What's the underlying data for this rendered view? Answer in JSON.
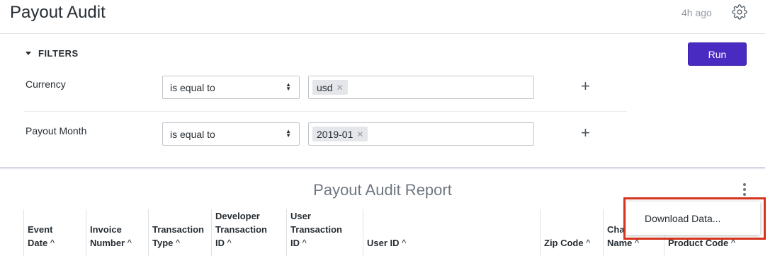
{
  "header": {
    "title": "Payout Audit",
    "updated": "4h ago",
    "settings_icon": "gear-icon"
  },
  "filters": {
    "toggle_label": "FILTERS",
    "run_label": "Run",
    "rows": [
      {
        "label": "Currency",
        "operator": "is equal to",
        "values": [
          "usd"
        ]
      },
      {
        "label": "Payout Month",
        "operator": "is equal to",
        "values": [
          "2019-01"
        ]
      }
    ]
  },
  "report": {
    "title": "Payout Audit Report",
    "columns": [
      {
        "lines": [
          "Event",
          "Date"
        ],
        "arrow": "^"
      },
      {
        "lines": [
          "Invoice",
          "Number"
        ],
        "arrow": "^"
      },
      {
        "lines": [
          "Transaction",
          "Type"
        ],
        "arrow": "^"
      },
      {
        "lines": [
          "Developer",
          "Transaction",
          "ID"
        ],
        "arrow": "^"
      },
      {
        "lines": [
          "User",
          "Transaction",
          "ID"
        ],
        "arrow": "^"
      },
      {
        "lines": [
          "User ID"
        ],
        "arrow": "^"
      },
      {
        "lines": [
          "Zip Code"
        ],
        "arrow": "^"
      },
      {
        "lines": [
          "Cha",
          "Name"
        ],
        "arrow": "^"
      },
      {
        "lines": [
          "Product Code"
        ],
        "arrow": "^"
      }
    ]
  },
  "menu": {
    "download_label": "Download Data..."
  },
  "colors": {
    "accent": "#4a2bc2",
    "highlight": "#d6341d"
  }
}
